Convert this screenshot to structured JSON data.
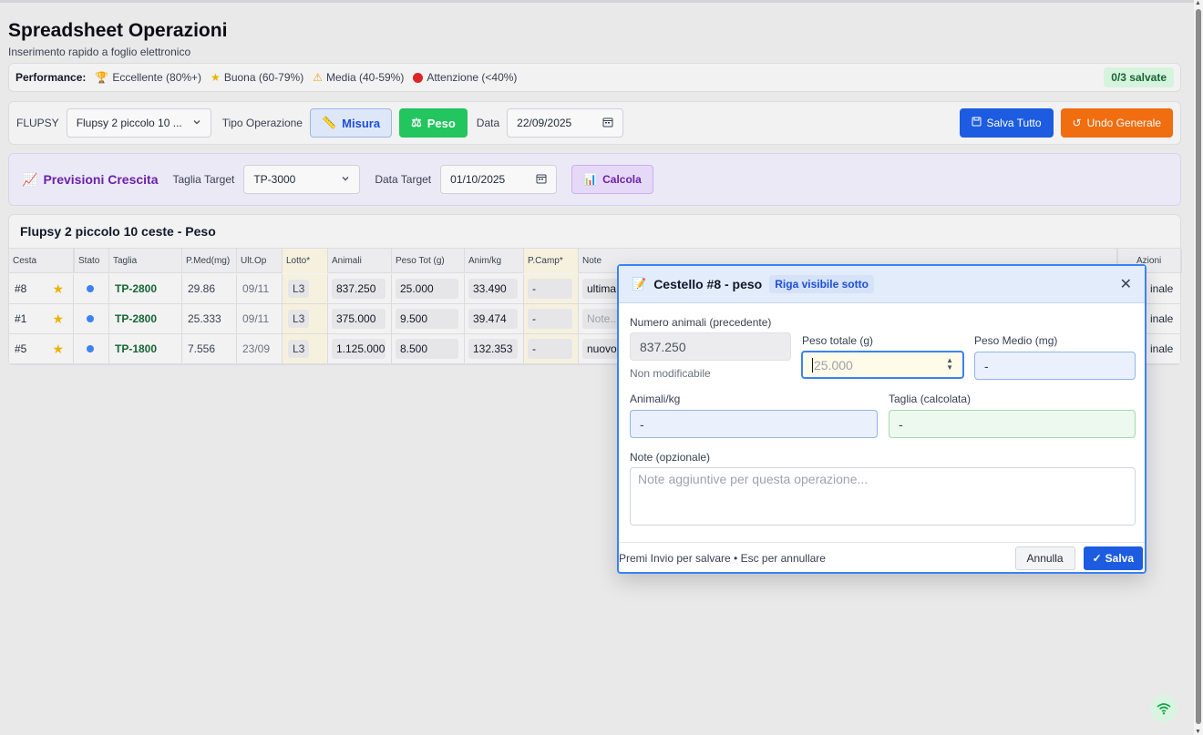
{
  "header": {
    "title": "Spreadsheet Operazioni",
    "subtitle": "Inserimento rapido a foglio elettronico"
  },
  "performance": {
    "label": "Performance:",
    "items": [
      {
        "icon": "trophy-icon",
        "text": "Eccellente (80%+)"
      },
      {
        "icon": "star-icon",
        "text": "Buona (60-79%)"
      },
      {
        "icon": "warning-icon",
        "text": "Media (40-59%)"
      },
      {
        "icon": "red-circle-icon",
        "text": "Attenzione (<40%)"
      }
    ],
    "saved": "0/3 salvate"
  },
  "toolbar": {
    "flupsy_label": "FLUPSY",
    "flupsy_value": "Flupsy 2 piccolo 10 ...",
    "tipo_label": "Tipo Operazione",
    "misura_label": "Misura",
    "peso_label": "Peso",
    "data_label": "Data",
    "data_value": "22/09/2025",
    "salva_tutto": "Salva Tutto",
    "undo": "Undo Generale"
  },
  "previsioni": {
    "title": "Previsioni Crescita",
    "taglia_label": "Taglia Target",
    "taglia_value": "TP-3000",
    "data_label": "Data Target",
    "data_value": "01/10/2025",
    "calcola": "Calcola"
  },
  "table": {
    "title": "Flupsy 2 piccolo 10 ceste - Peso",
    "headers": {
      "cesta": "Cesta",
      "stato": "Stato",
      "taglia": "Taglia",
      "pmed": "P.Med(mg)",
      "ultop": "Ult.Op",
      "lotto": "Lotto*",
      "animali": "Animali",
      "pesotot": "Peso Tot (g)",
      "animkg": "Anim/kg",
      "pcamp": "P.Camp*",
      "note": "Note",
      "azioni": "Azioni"
    },
    "rows": [
      {
        "cesta": "#8",
        "taglia": "TP-2800",
        "pmed": "29.86",
        "ultop": "09/11",
        "lotto": "L3",
        "animali": "837.250",
        "pesotot": "25.000",
        "animkg": "33.490",
        "pcamp": "-",
        "note": "ultima",
        "azioni": "inale"
      },
      {
        "cesta": "#1",
        "taglia": "TP-2800",
        "pmed": "25.333",
        "ultop": "09/11",
        "lotto": "L3",
        "animali": "375.000",
        "pesotot": "9.500",
        "animkg": "39.474",
        "pcamp": "-",
        "note": "Note...",
        "azioni": "inale"
      },
      {
        "cesta": "#5",
        "taglia": "TP-1800",
        "pmed": "7.556",
        "ultop": "23/09",
        "lotto": "L3",
        "animali": "1.125.000",
        "pesotot": "8.500",
        "animkg": "132.353",
        "pcamp": "-",
        "note": "nuovo",
        "azioni": "inale"
      }
    ]
  },
  "modal": {
    "title": "Cestello #8 - peso",
    "badge": "Riga visibile sotto",
    "numero_label": "Numero animali (precedente)",
    "numero_value": "837.250",
    "numero_hint": "Non modificabile",
    "peso_label": "Peso totale (g)",
    "peso_placeholder": "25.000",
    "pmedio_label": "Peso Medio (mg)",
    "pmedio_value": "-",
    "animkg_label": "Animali/kg",
    "animkg_value": "-",
    "taglia_label": "Taglia (calcolata)",
    "taglia_value": "-",
    "note_label": "Note (opzionale)",
    "note_placeholder": "Note aggiuntive per questa operazione...",
    "hint": "Premi Invio per salvare • Esc per annullare",
    "annulla": "Annulla",
    "salva": "Salva"
  },
  "colors": {
    "primary": "#1d5ce0",
    "success": "#22c55e",
    "warning": "#f06d10",
    "purple": "#6b21a8"
  }
}
